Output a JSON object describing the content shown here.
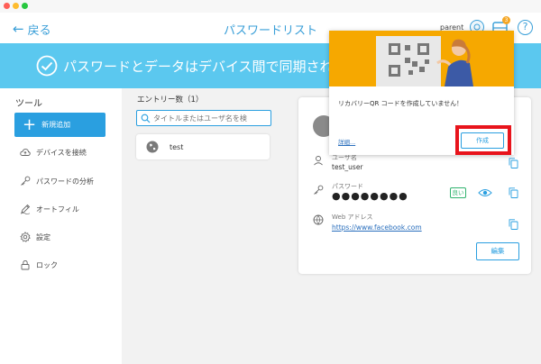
{
  "app": {
    "title": "パスワードリスト",
    "back_label": "戻る",
    "user_name": "parent",
    "notification_count": "3",
    "help_label": "?"
  },
  "banner": {
    "text": "パスワードとデータはデバイス間で同期されています"
  },
  "sidebar": {
    "heading": "ツール",
    "new_button": "新規追加",
    "items": [
      {
        "label": "デバイスを接続",
        "icon": "cloud-icon"
      },
      {
        "label": "パスワードの分析",
        "icon": "key-icon"
      },
      {
        "label": "オートフィル",
        "icon": "pen-icon"
      },
      {
        "label": "設定",
        "icon": "gear-icon"
      },
      {
        "label": "ロック",
        "icon": "lock-icon"
      }
    ]
  },
  "list": {
    "entry_count": "エントリー数（1）",
    "search_placeholder": "タイトルまたはユーザ名を検",
    "entries": [
      {
        "name": "test"
      }
    ]
  },
  "detail": {
    "user_label": "ユーザ名",
    "user_value": "test_user",
    "password_label": "パスワード",
    "password_value": "●●●●●●●●",
    "strength": "良い",
    "web_label": "Web アドレス",
    "web_value": "https://www.facebook.com",
    "edit_button": "編集"
  },
  "popup": {
    "message": "リカバリーQR コードを作成していません！",
    "link": "詳細...",
    "create_button": "作成"
  },
  "colors": {
    "accent": "#2a9fe0",
    "banner": "#5bc8ef",
    "highlight": "#e8141c",
    "illustration": "#f6a800",
    "strength_good": "#2fb36d"
  }
}
